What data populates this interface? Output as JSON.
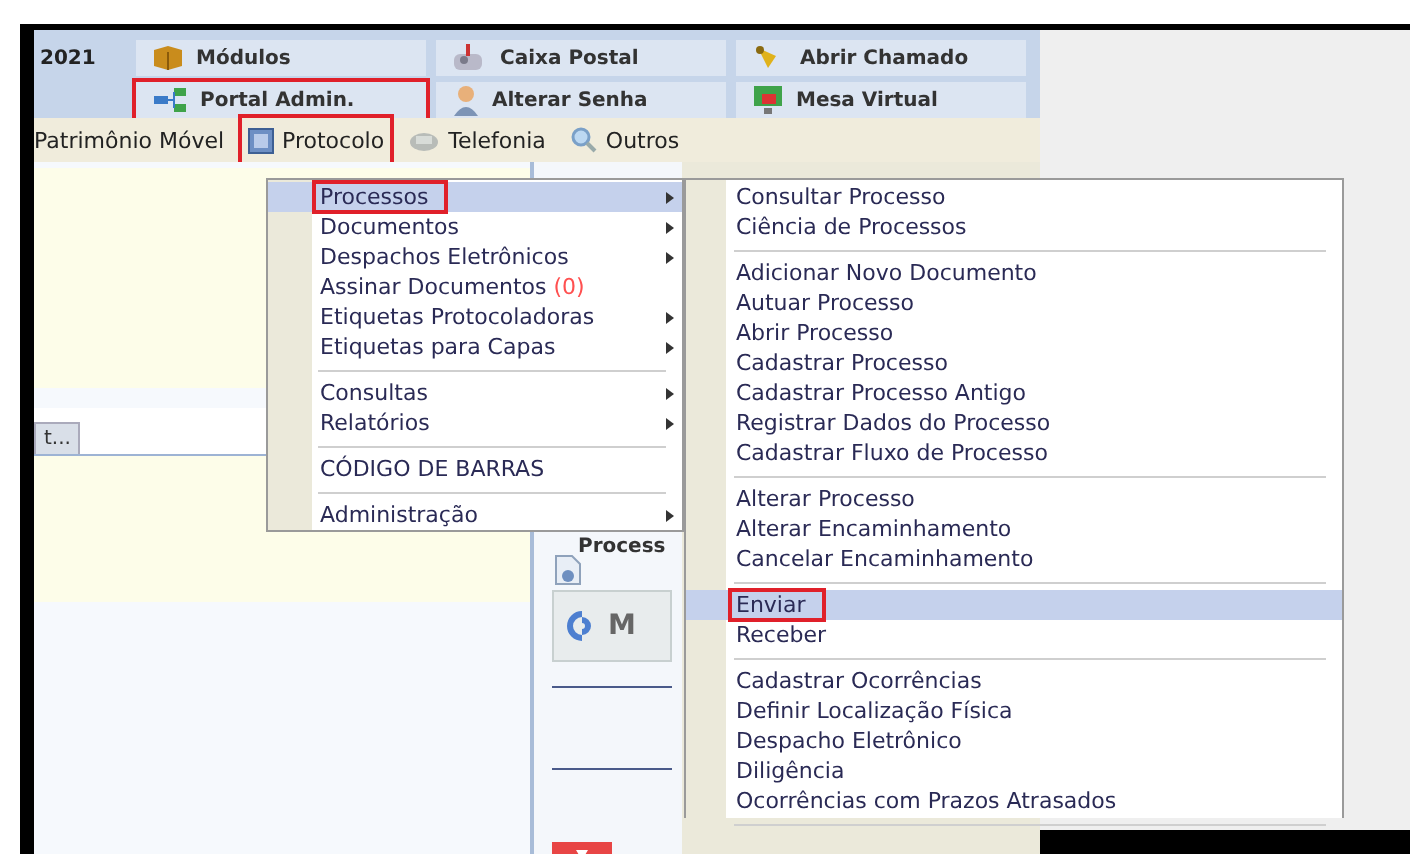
{
  "header": {
    "year": "2021",
    "shortcuts": [
      {
        "label": "Módulos",
        "marked": false
      },
      {
        "label": "Caixa Postal",
        "marked": false
      },
      {
        "label": "Abrir Chamado",
        "marked": false
      },
      {
        "label": "Portal Admin.",
        "marked": true
      },
      {
        "label": "Alterar Senha",
        "marked": false
      },
      {
        "label": "Mesa Virtual",
        "marked": false
      }
    ]
  },
  "menubar": [
    {
      "label": "Patrimônio Móvel",
      "marked": false
    },
    {
      "label": "Protocolo",
      "marked": true
    },
    {
      "label": "Telefonia",
      "marked": false
    },
    {
      "label": "Outros",
      "marked": false
    }
  ],
  "page": {
    "tab": "t...",
    "process_label": "Process",
    "logo_text": "M"
  },
  "menu": {
    "items": [
      {
        "kind": "item",
        "label": "Processos",
        "submenu": true,
        "selected": true,
        "marked": true
      },
      {
        "kind": "item",
        "label": "Documentos",
        "submenu": true,
        "selected": false,
        "marked": false
      },
      {
        "kind": "item",
        "label": "Despachos Eletrônicos",
        "submenu": true,
        "selected": false,
        "marked": false
      },
      {
        "kind": "item",
        "label": "Assinar Documentos",
        "count": "(0)",
        "submenu": false,
        "selected": false,
        "marked": false
      },
      {
        "kind": "item",
        "label": "Etiquetas Protocoladoras",
        "submenu": true,
        "selected": false,
        "marked": false
      },
      {
        "kind": "item",
        "label": "Etiquetas para Capas",
        "submenu": true,
        "selected": false,
        "marked": false
      },
      {
        "kind": "separator"
      },
      {
        "kind": "item",
        "label": "Consultas",
        "submenu": true,
        "selected": false,
        "marked": false
      },
      {
        "kind": "item",
        "label": "Relatórios",
        "submenu": true,
        "selected": false,
        "marked": false
      },
      {
        "kind": "separator"
      },
      {
        "kind": "item",
        "label": "CÓDIGO DE BARRAS",
        "submenu": false,
        "selected": false,
        "marked": false
      },
      {
        "kind": "separator"
      },
      {
        "kind": "item",
        "label": "Administração",
        "submenu": true,
        "selected": false,
        "marked": false
      }
    ]
  },
  "submenu": {
    "items": [
      {
        "kind": "item",
        "label": "Consultar Processo",
        "selected": false,
        "marked": false
      },
      {
        "kind": "item",
        "label": "Ciência de Processos",
        "selected": false,
        "marked": false
      },
      {
        "kind": "separator"
      },
      {
        "kind": "item",
        "label": "Adicionar Novo Documento",
        "selected": false,
        "marked": false
      },
      {
        "kind": "item",
        "label": "Autuar Processo",
        "selected": false,
        "marked": false
      },
      {
        "kind": "item",
        "label": "Abrir Processo",
        "selected": false,
        "marked": false
      },
      {
        "kind": "item",
        "label": "Cadastrar Processo",
        "selected": false,
        "marked": false
      },
      {
        "kind": "item",
        "label": "Cadastrar Processo Antigo",
        "selected": false,
        "marked": false
      },
      {
        "kind": "item",
        "label": "Registrar Dados do Processo",
        "selected": false,
        "marked": false
      },
      {
        "kind": "item",
        "label": "Cadastrar Fluxo de Processo",
        "selected": false,
        "marked": false
      },
      {
        "kind": "separator"
      },
      {
        "kind": "item",
        "label": "Alterar Processo",
        "selected": false,
        "marked": false
      },
      {
        "kind": "item",
        "label": "Alterar Encaminhamento",
        "selected": false,
        "marked": false
      },
      {
        "kind": "item",
        "label": "Cancelar Encaminhamento",
        "selected": false,
        "marked": false
      },
      {
        "kind": "separator"
      },
      {
        "kind": "item",
        "label": "Enviar",
        "selected": true,
        "marked": true
      },
      {
        "kind": "item",
        "label": "Receber",
        "selected": false,
        "marked": false
      },
      {
        "kind": "separator"
      },
      {
        "kind": "item",
        "label": "Cadastrar Ocorrências",
        "selected": false,
        "marked": false
      },
      {
        "kind": "item",
        "label": "Definir Localização Física",
        "selected": false,
        "marked": false
      },
      {
        "kind": "item",
        "label": "Despacho Eletrônico",
        "selected": false,
        "marked": false
      },
      {
        "kind": "item",
        "label": "Diligência",
        "selected": false,
        "marked": false
      },
      {
        "kind": "item",
        "label": "Ocorrências com Prazos Atrasados",
        "selected": false,
        "marked": false
      },
      {
        "kind": "separator"
      }
    ]
  }
}
